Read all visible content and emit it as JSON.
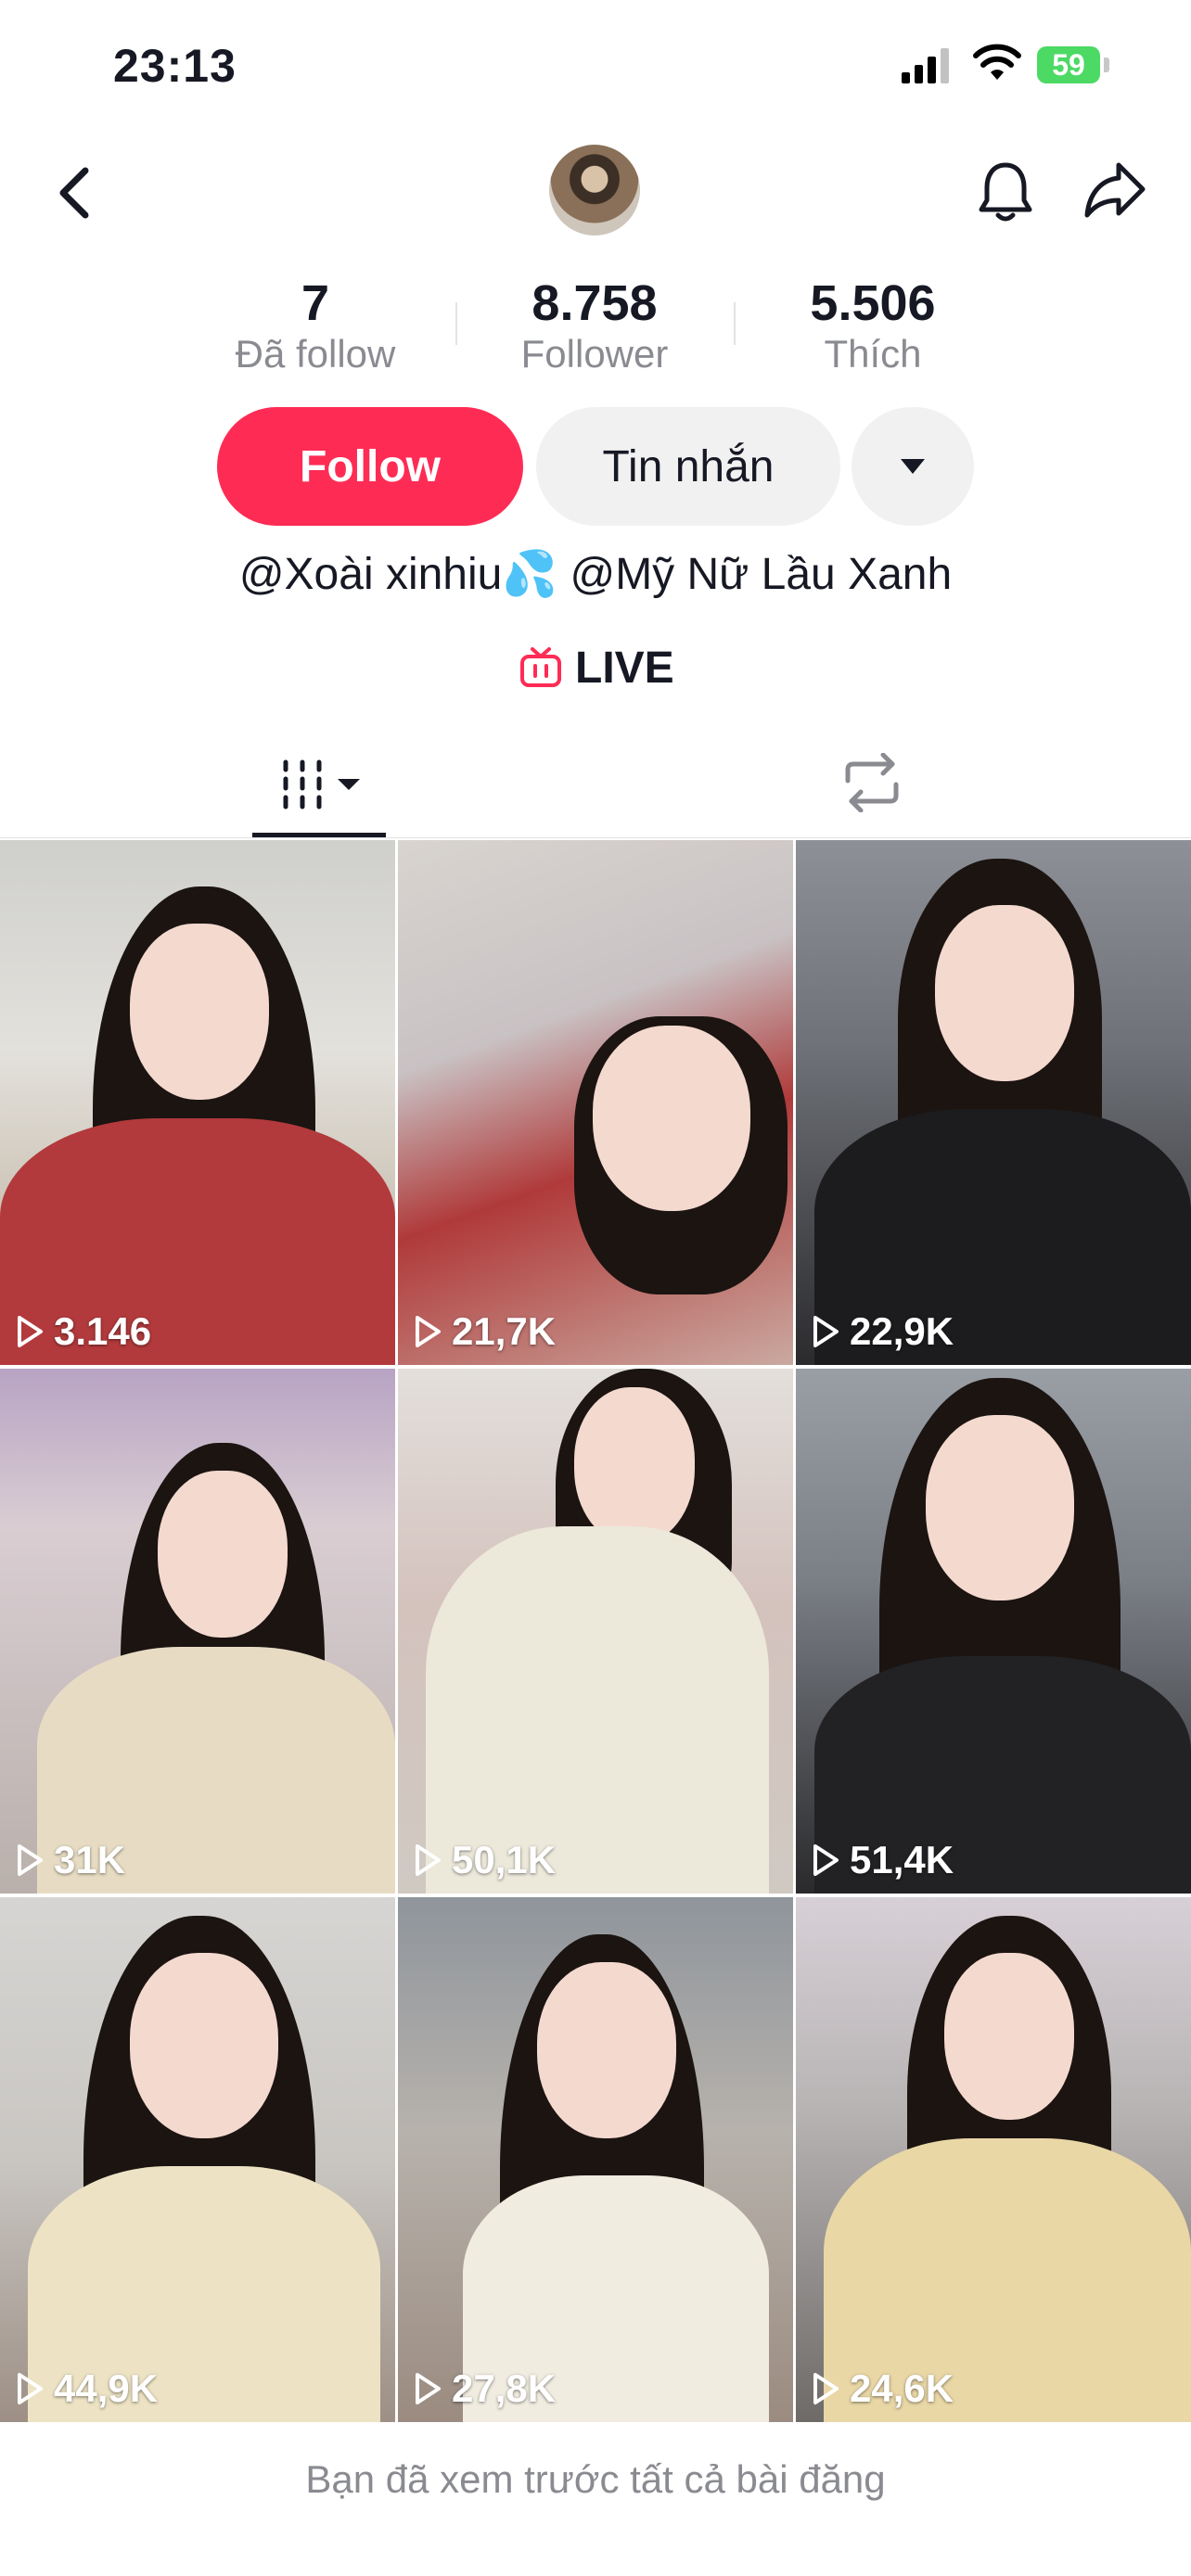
{
  "status_bar": {
    "time": "23:13",
    "battery": "59"
  },
  "profile": {
    "stats": [
      {
        "value": "7",
        "label": "Đã follow"
      },
      {
        "value": "8.758",
        "label": "Follower"
      },
      {
        "value": "5.506",
        "label": "Thích"
      }
    ],
    "follow_label": "Follow",
    "message_label": "Tin nhắn",
    "bio": "@Xoài xinhiu💦 @Mỹ Nữ Lầu Xanh",
    "live_label": "LIVE"
  },
  "colors": {
    "accent": "#fe2c55",
    "live": "#fe2c55",
    "text": "#161823",
    "muted": "#8a8b91"
  },
  "videos": [
    {
      "views": "3.146"
    },
    {
      "views": "21,7K"
    },
    {
      "views": "22,9K"
    },
    {
      "views": "31K"
    },
    {
      "views": "50,1K"
    },
    {
      "views": "51,4K"
    },
    {
      "views": "44,9K"
    },
    {
      "views": "27,8K"
    },
    {
      "views": "24,6K"
    }
  ],
  "footer": {
    "text": "Bạn đã xem trước tất cả bài đăng"
  }
}
